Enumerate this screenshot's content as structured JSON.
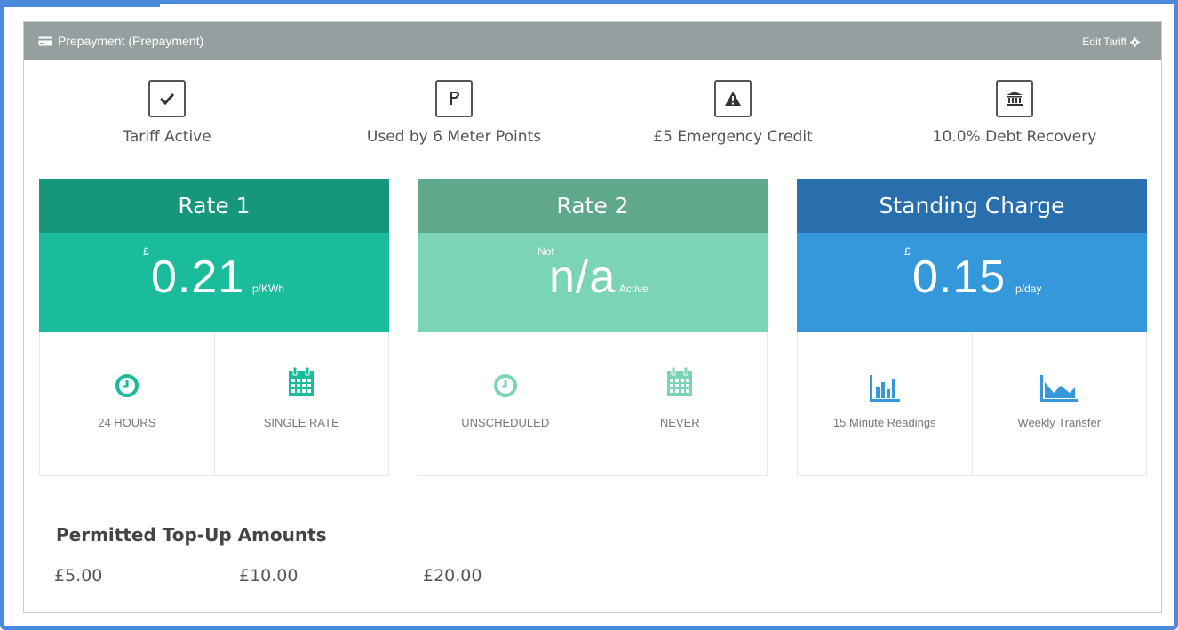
{
  "panel": {
    "title": "Prepayment (Prepayment)",
    "edit_label": "Edit Tariff"
  },
  "features": [
    {
      "label": "Tariff Active",
      "icon": "checkmark-icon"
    },
    {
      "label": "Used by 6 Meter Points",
      "icon": "meter-point-icon"
    },
    {
      "label": "£5 Emergency Credit",
      "icon": "warning-icon"
    },
    {
      "label": "10.0% Debt Recovery",
      "icon": "bank-icon"
    }
  ],
  "cards": [
    {
      "title": "Rate 1",
      "currency": "£",
      "value": "0.21",
      "unit": "p/KWh",
      "colors": {
        "head": "#16967a",
        "body": "#1abc9c",
        "icon": "#1abc9c"
      },
      "cells": [
        {
          "label": "24 HOURS",
          "icon": "clock-icon"
        },
        {
          "label": "SINGLE RATE",
          "icon": "calendar-icon"
        }
      ]
    },
    {
      "title": "Rate 2",
      "currency": "Not",
      "value": "n/a",
      "unit": "Active",
      "colors": {
        "head": "#5fa88b",
        "body": "#7bd5b4",
        "icon": "#7bd5b4"
      },
      "cells": [
        {
          "label": "UNSCHEDULED",
          "icon": "clock-icon"
        },
        {
          "label": "NEVER",
          "icon": "calendar-icon"
        }
      ]
    },
    {
      "title": "Standing Charge",
      "currency": "£",
      "value": "0.15",
      "unit": "p/day",
      "colors": {
        "head": "#2a6fad",
        "body": "#3498db",
        "icon": "#3498db"
      },
      "cells": [
        {
          "label": "15 Minute Readings",
          "icon": "bar-chart-icon"
        },
        {
          "label": "Weekly Transfer",
          "icon": "area-chart-icon"
        }
      ]
    }
  ],
  "topup": {
    "title": "Permitted Top-Up Amounts",
    "amounts": [
      "£5.00",
      "£10.00",
      "£20.00"
    ]
  }
}
